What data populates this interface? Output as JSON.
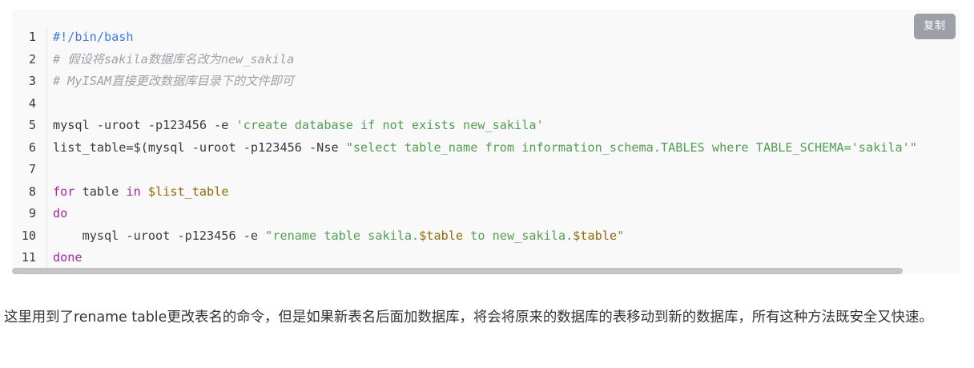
{
  "code_block": {
    "copy_label": "复制",
    "lines": [
      {
        "num": "1",
        "segments": [
          {
            "t": "#!/bin/bash",
            "c": "meta"
          }
        ]
      },
      {
        "num": "2",
        "segments": [
          {
            "t": "# 假设将sakila数据库名改为new_sakila",
            "c": "comment"
          }
        ]
      },
      {
        "num": "3",
        "segments": [
          {
            "t": "# MyISAM直接更改数据库目录下的文件即可",
            "c": "comment"
          }
        ]
      },
      {
        "num": "4",
        "segments": []
      },
      {
        "num": "5",
        "segments": [
          {
            "t": "mysql -uroot -p123456 -e ",
            "c": "plain"
          },
          {
            "t": "'create database if not exists new_sakila'",
            "c": "string"
          }
        ]
      },
      {
        "num": "6",
        "segments": [
          {
            "t": "list_table=$(mysql -uroot -p123456 -Nse ",
            "c": "plain"
          },
          {
            "t": "\"select table_name from information_schema.TABLES where TABLE_SCHEMA='sakila'\"",
            "c": "string"
          }
        ]
      },
      {
        "num": "7",
        "segments": []
      },
      {
        "num": "8",
        "segments": [
          {
            "t": "for",
            "c": "keyword"
          },
          {
            "t": " table ",
            "c": "plain"
          },
          {
            "t": "in",
            "c": "keyword"
          },
          {
            "t": " ",
            "c": "plain"
          },
          {
            "t": "$list_table",
            "c": "var"
          }
        ]
      },
      {
        "num": "9",
        "segments": [
          {
            "t": "do",
            "c": "keyword"
          }
        ]
      },
      {
        "num": "10",
        "segments": [
          {
            "t": "    mysql -uroot -p123456 -e ",
            "c": "plain"
          },
          {
            "t": "\"rename table sakila.",
            "c": "string"
          },
          {
            "t": "$table",
            "c": "var"
          },
          {
            "t": " to new_sakila.",
            "c": "string"
          },
          {
            "t": "$table",
            "c": "var"
          },
          {
            "t": "\"",
            "c": "string"
          }
        ]
      },
      {
        "num": "11",
        "segments": [
          {
            "t": "done",
            "c": "keyword"
          }
        ]
      }
    ]
  },
  "paragraph": "这里用到了rename table更改表名的命令，但是如果新表名后面加数据库，将会将原来的数据库的表移动到新的数据库，所有这种方法既安全又快速。"
}
